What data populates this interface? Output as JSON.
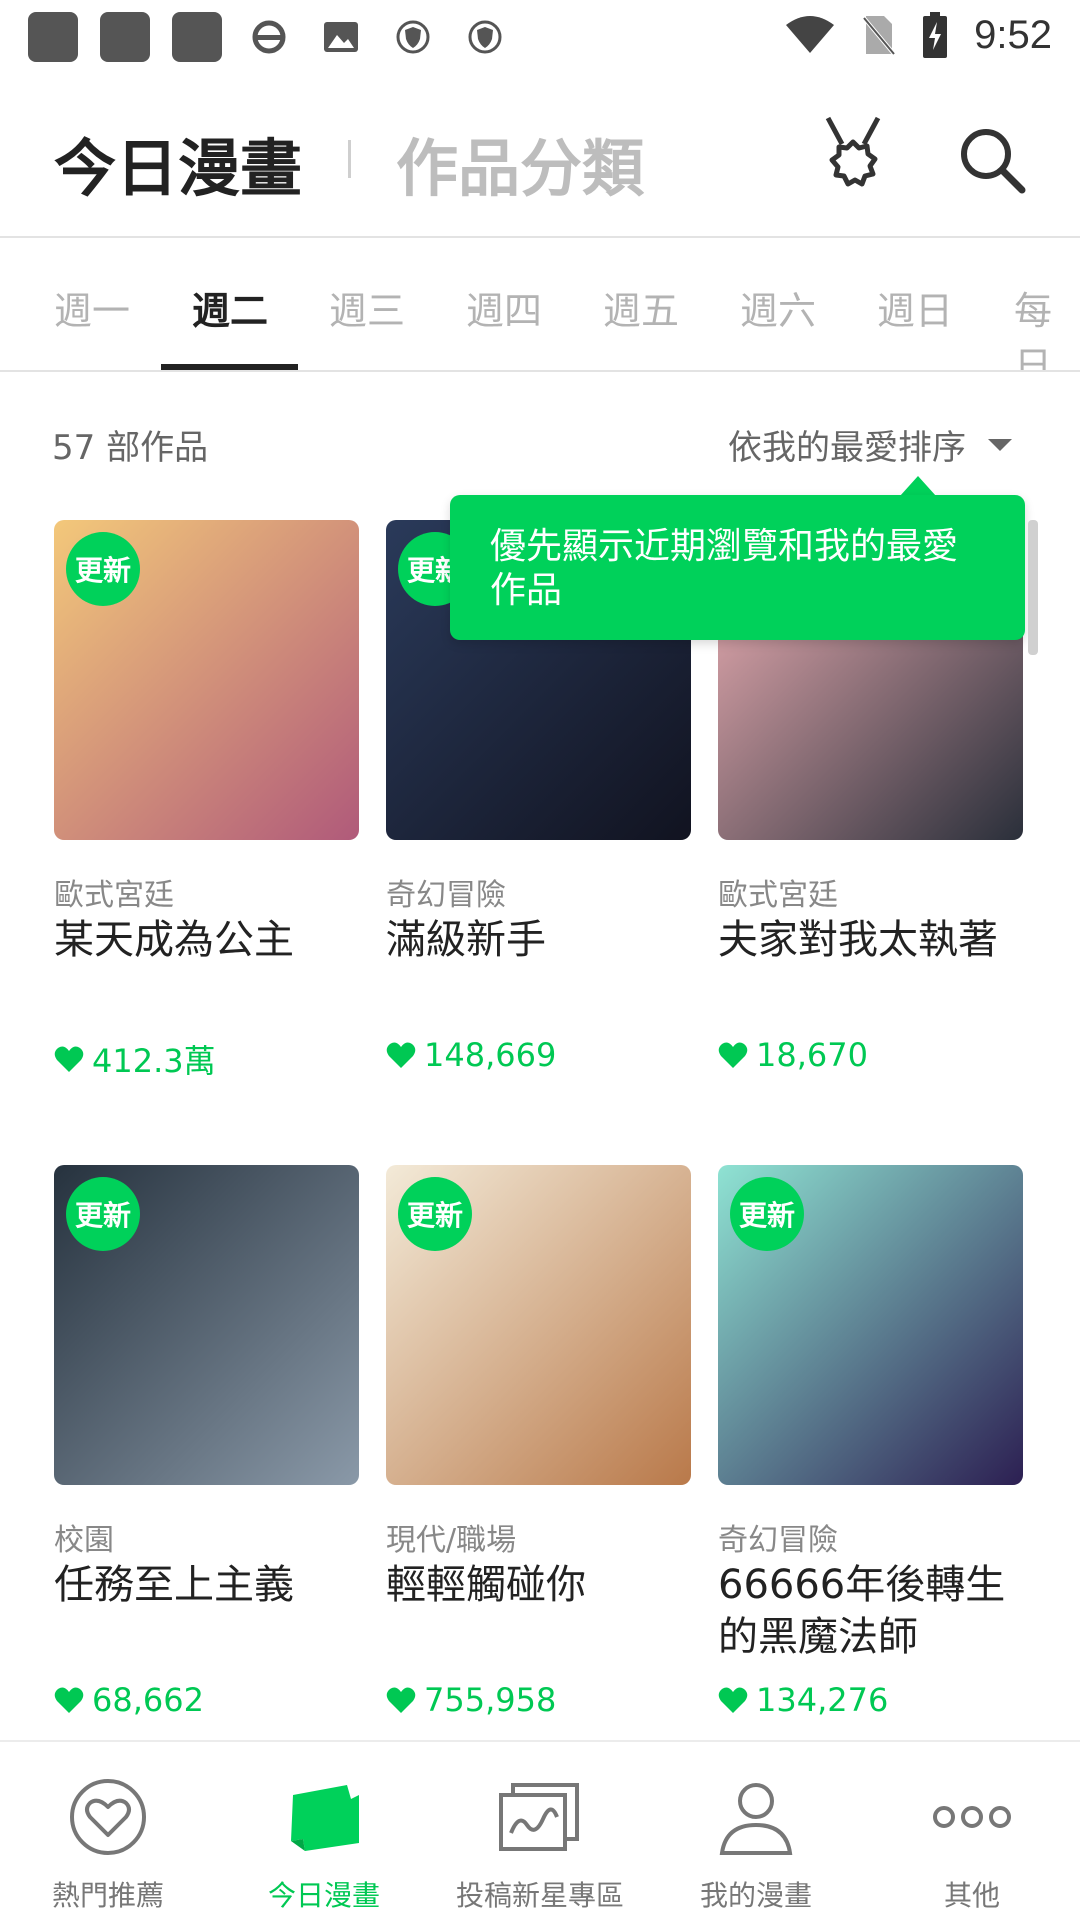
{
  "status_bar": {
    "time": "9:52"
  },
  "header": {
    "tab_today": "今日漫畫",
    "tab_genre": "作品分類"
  },
  "day_tabs": [
    "週一",
    "週二",
    "週三",
    "週四",
    "週五",
    "週六",
    "週日",
    "每日"
  ],
  "active_day_index": 1,
  "list": {
    "count_label": "57 部作品",
    "sort_label": "依我的最愛排序"
  },
  "tooltip": {
    "text": "優先顯示近期瀏覽和我的最愛作品"
  },
  "comics": [
    {
      "badge": "更新",
      "genre": "歐式宮廷",
      "title": "某天成為公主",
      "likes": "412.3萬",
      "colors": [
        "#f3c87a",
        "#b05a7a"
      ]
    },
    {
      "badge": "更新",
      "genre": "奇幻冒險",
      "title": "滿級新手",
      "likes": "148,669",
      "colors": [
        "#2a3a5a",
        "#111320"
      ]
    },
    {
      "badge": "",
      "genre": "歐式宮廷",
      "title": "夫家對我太執著",
      "likes": "18,670",
      "colors": [
        "#f3b3b8",
        "#2a2f3a"
      ]
    },
    {
      "badge": "更新",
      "genre": "校園",
      "title": "任務至上主義",
      "likes": "68,662",
      "colors": [
        "#26323e",
        "#8a99a8"
      ]
    },
    {
      "badge": "更新",
      "genre": "現代/職場",
      "title": "輕輕觸碰你",
      "likes": "755,958",
      "colors": [
        "#f3ead8",
        "#b9794a"
      ]
    },
    {
      "badge": "更新",
      "genre": "奇幻冒險",
      "title": "66666年後轉生的黑魔法師",
      "likes": "134,276",
      "colors": [
        "#8fe3d3",
        "#2c1f52"
      ]
    }
  ],
  "bottom_nav": [
    {
      "label": "熱門推薦",
      "icon": "heart-icon"
    },
    {
      "label": "今日漫畫",
      "icon": "today-comics-icon"
    },
    {
      "label": "投稿新星專區",
      "icon": "canvas-icon"
    },
    {
      "label": "我的漫畫",
      "icon": "person-icon"
    },
    {
      "label": "其他",
      "icon": "more-icon"
    }
  ],
  "active_nav_index": 1,
  "accent_color": "#00d15a"
}
